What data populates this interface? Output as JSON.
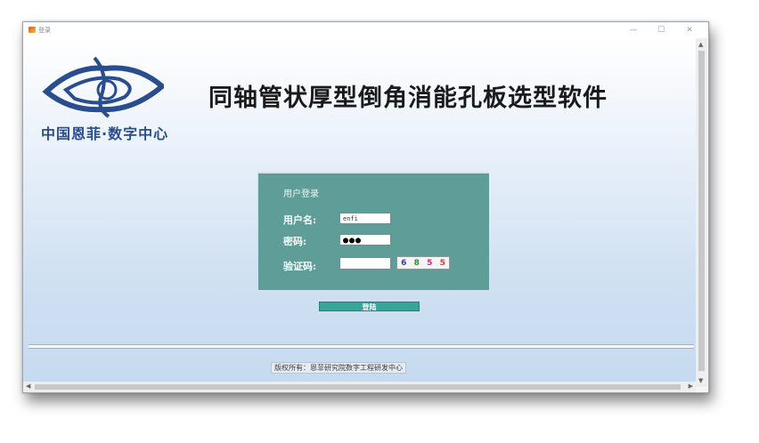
{
  "window": {
    "title": "登录",
    "controls": {
      "minimize": "—",
      "maximize": "☐",
      "close": "✕"
    }
  },
  "header": {
    "logo_icon": "eye-logo-icon",
    "org_name": "中国恩菲·数字中心",
    "app_title": "同轴管状厚型倒角消能孔板选型软件"
  },
  "login": {
    "panel_title": "用户登录",
    "username_label": "用户名:",
    "username_value": "enfi",
    "password_label": "密码:",
    "password_value": "●●●",
    "captcha_label": "验证码:",
    "captcha_value": "",
    "captcha_chars": [
      "6",
      "8",
      "5",
      "5"
    ],
    "submit_label": "登陆"
  },
  "footer": {
    "copyright": "版权所有：恩菲研究院数字工程研发中心"
  },
  "scrollbars": {
    "up": "▲",
    "down": "▼",
    "left": "◀",
    "right": "▶"
  },
  "colors": {
    "panel": "#5f9d98",
    "button": "#39a598",
    "title_text": "#1a1a1a",
    "org_text": "#2a4d8e"
  }
}
